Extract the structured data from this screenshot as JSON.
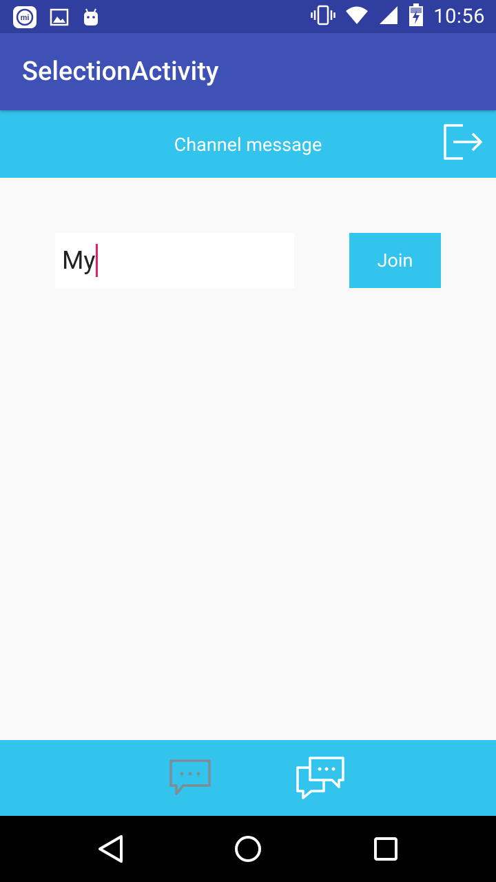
{
  "status_bar": {
    "time": "10:56",
    "left_icons": [
      "mi-icon",
      "image-icon",
      "android-icon"
    ],
    "right_icons": [
      "vibrate-icon",
      "wifi-icon",
      "signal-icon",
      "battery-charging-icon"
    ]
  },
  "app_bar": {
    "title": "SelectionActivity"
  },
  "channel_bar": {
    "label": "Channel message",
    "action_icon": "logout-icon"
  },
  "form": {
    "channel_input_value": "My",
    "join_label": "Join"
  },
  "bottom_tabs": [
    {
      "icon": "chat-bubble-icon",
      "active": false
    },
    {
      "icon": "chat-bubbles-icon",
      "active": true
    }
  ],
  "colors": {
    "status": "#303f9f",
    "primary": "#3f51b5",
    "accent": "#33c4ee",
    "cursor": "#e91e63"
  }
}
